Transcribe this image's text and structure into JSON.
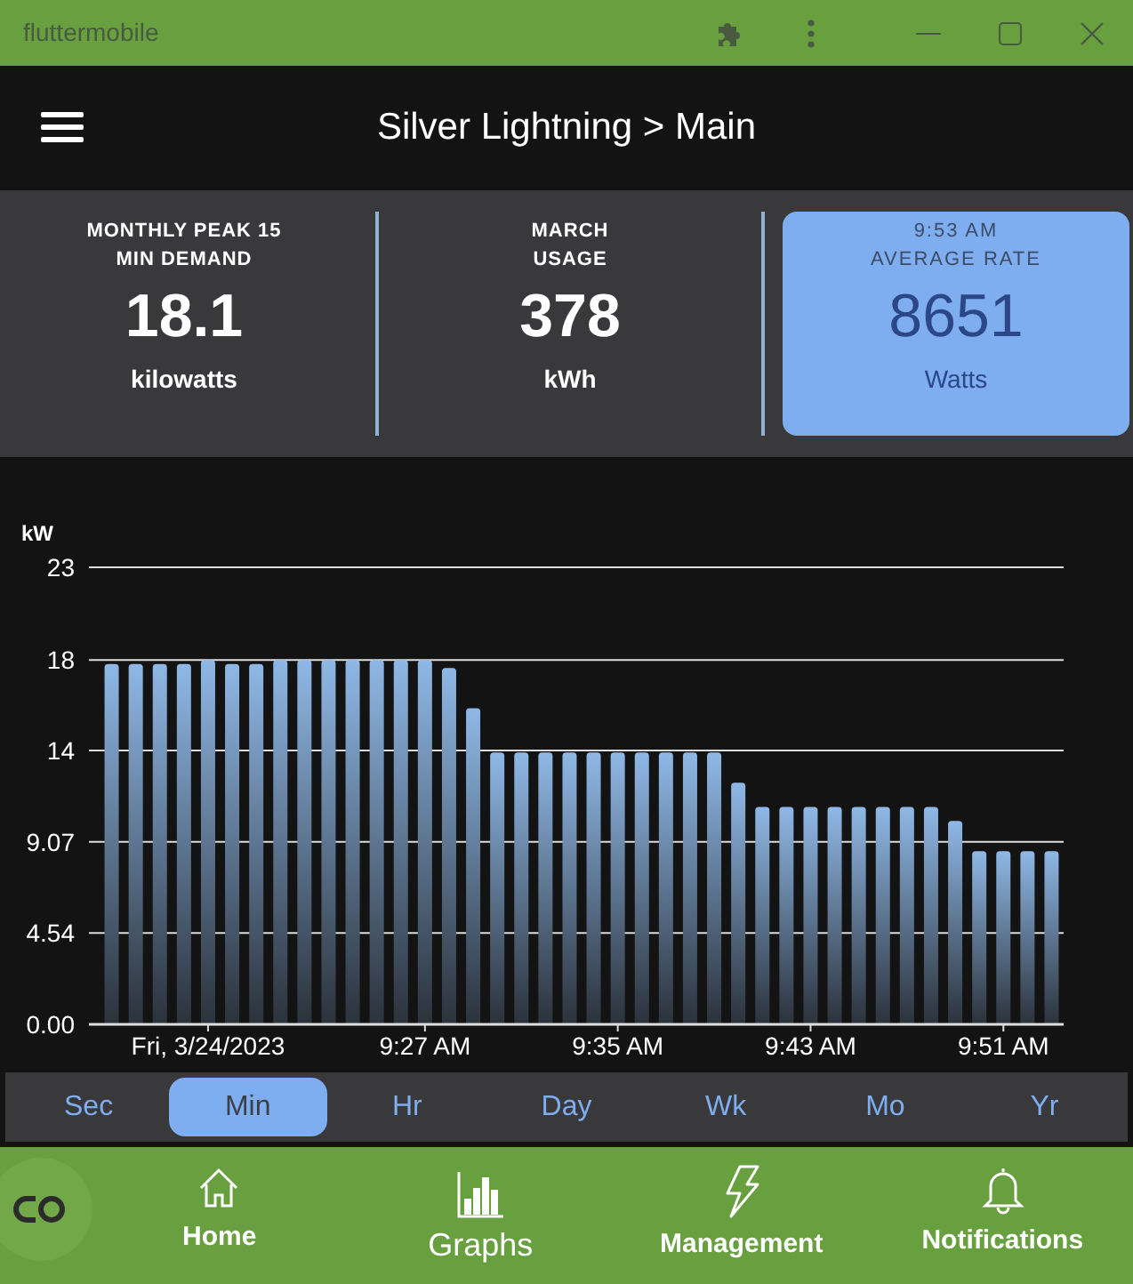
{
  "window": {
    "title": "fluttermobile"
  },
  "app_bar": {
    "title": "Silver Lightning > Main"
  },
  "stats": [
    {
      "label_lines": [
        "MONTHLY PEAK 15",
        "MIN DEMAND"
      ],
      "value": "18.1",
      "unit": "kilowatts",
      "selected": false
    },
    {
      "label_lines": [
        "MARCH",
        "USAGE"
      ],
      "value": "378",
      "unit": "kWh",
      "selected": false
    },
    {
      "label_lines": [
        "9:53 AM",
        "AVERAGE RATE"
      ],
      "value": "8651",
      "unit": "Watts",
      "selected": true
    }
  ],
  "chart": {
    "chart_data": {
      "type": "bar",
      "ylabel": "kW",
      "grid": true,
      "categories": [
        null,
        null,
        null,
        null,
        "Fri, 3/24/2023",
        null,
        null,
        null,
        null,
        null,
        null,
        null,
        null,
        "9:27 AM",
        null,
        null,
        null,
        null,
        null,
        null,
        null,
        "9:35 AM",
        null,
        null,
        null,
        null,
        null,
        null,
        null,
        "9:43 AM",
        null,
        null,
        null,
        null,
        null,
        null,
        null,
        "9:51 AM",
        null,
        null
      ],
      "series": [
        {
          "color": "#8fb8e6",
          "values": [
            17.9,
            17.9,
            17.9,
            17.9,
            18.1,
            17.9,
            17.9,
            18.1,
            18.1,
            18.1,
            18.1,
            18.1,
            18.1,
            18.1,
            17.7,
            15.7,
            13.5,
            13.5,
            13.5,
            13.5,
            13.5,
            13.5,
            13.5,
            13.5,
            13.5,
            13.5,
            12.0,
            10.8,
            10.8,
            10.8,
            10.8,
            10.8,
            10.8,
            10.8,
            10.8,
            10.1,
            8.6,
            8.6,
            8.6,
            8.6
          ]
        }
      ],
      "ylim": [
        0,
        22.7
      ],
      "yticks": [
        {
          "value": 0,
          "label": "0.00"
        },
        {
          "value": 4.54,
          "label": "4.54"
        },
        {
          "value": 9.07,
          "label": "9.07"
        },
        {
          "value": 13.6,
          "label": "14"
        },
        {
          "value": 18.1,
          "label": "18"
        },
        {
          "value": 22.7,
          "label": "23"
        }
      ]
    }
  },
  "ranges": [
    {
      "label": "Sec",
      "selected": false
    },
    {
      "label": "Min",
      "selected": true
    },
    {
      "label": "Hr",
      "selected": false
    },
    {
      "label": "Day",
      "selected": false
    },
    {
      "label": "Wk",
      "selected": false
    },
    {
      "label": "Mo",
      "selected": false
    },
    {
      "label": "Yr",
      "selected": false
    }
  ],
  "bottom_nav": [
    {
      "label": "Home",
      "selected": false
    },
    {
      "label": "Graphs",
      "selected": true
    },
    {
      "label": "Management",
      "selected": false
    },
    {
      "label": "Notifications",
      "selected": false
    }
  ]
}
